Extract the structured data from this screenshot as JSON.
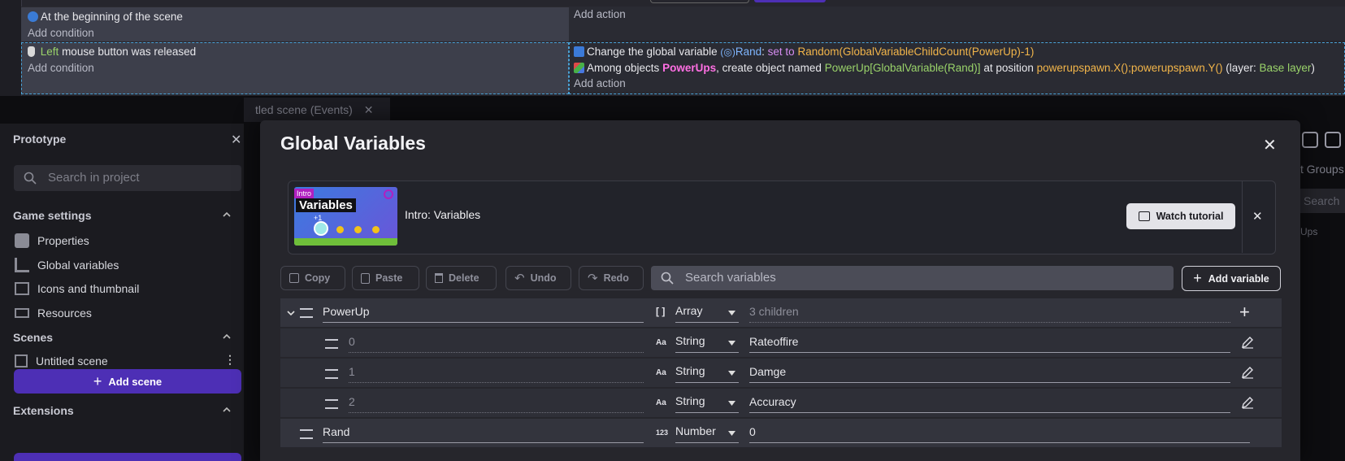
{
  "events": {
    "event1": {
      "condition": "At the beginning of the scene",
      "add_condition": "Add condition",
      "add_action": "Add action"
    },
    "event2": {
      "condition_key": "Left",
      "condition_rest": "mouse button was released",
      "add_condition": "Add condition",
      "action1": {
        "prefix": "Change the global variable",
        "var": "Rand",
        "colon": ":",
        "set_to": "set to",
        "value": "Random(GlobalVariableChildCount(PowerUp)-1)"
      },
      "action2": {
        "prefix": "Among objects",
        "objects": "PowerUps",
        "mid": ", create object named",
        "name_expr": "PowerUp[GlobalVariable(Rand)]",
        "at_position": "at position",
        "position_expr": "powerupspawn.X();powerupspawn.Y()",
        "layer_open": "(layer:",
        "layer": "Base layer",
        "layer_close": ")"
      },
      "add_action": "Add action"
    }
  },
  "behind": {
    "tab_label": "tled scene (Events)",
    "groups_label": "t Groups",
    "search_label": "Search",
    "ups_label": "Ups"
  },
  "project": {
    "title": "Prototype",
    "search_placeholder": "Search in project",
    "game_settings": "Game settings",
    "items": [
      "Properties",
      "Global variables",
      "Icons and thumbnail",
      "Resources"
    ],
    "scenes": "Scenes",
    "scene_name": "Untitled scene",
    "add_scene": "Add scene",
    "extensions": "Extensions"
  },
  "modal": {
    "title": "Global Variables",
    "tutorial": {
      "thumb_badge": "Intro",
      "thumb_title": "Variables",
      "thumb_plus": "+1",
      "title": "Intro: Variables",
      "watch": "Watch tutorial"
    },
    "toolbar": {
      "copy": "Copy",
      "paste": "Paste",
      "delete": "Delete",
      "undo": "Undo",
      "redo": "Redo",
      "search_placeholder": "Search variables",
      "add": "Add variable"
    },
    "variables": [
      {
        "name": "PowerUp",
        "type_icon": "[ ]",
        "type": "Array",
        "value": "3 children"
      },
      {
        "name": "0",
        "type_icon": "Aa",
        "type": "String",
        "value": "Rateoffire"
      },
      {
        "name": "1",
        "type_icon": "Aa",
        "type": "String",
        "value": "Damge"
      },
      {
        "name": "2",
        "type_icon": "Aa",
        "type": "String",
        "value": "Accuracy"
      },
      {
        "name": "Rand",
        "type_icon": "123",
        "type": "Number",
        "value": "0"
      }
    ]
  },
  "colors": {
    "accent": "#4d2fb5",
    "pink": "#ff6fe3",
    "green": "#9ad36a",
    "orange": "#f2b54a"
  }
}
